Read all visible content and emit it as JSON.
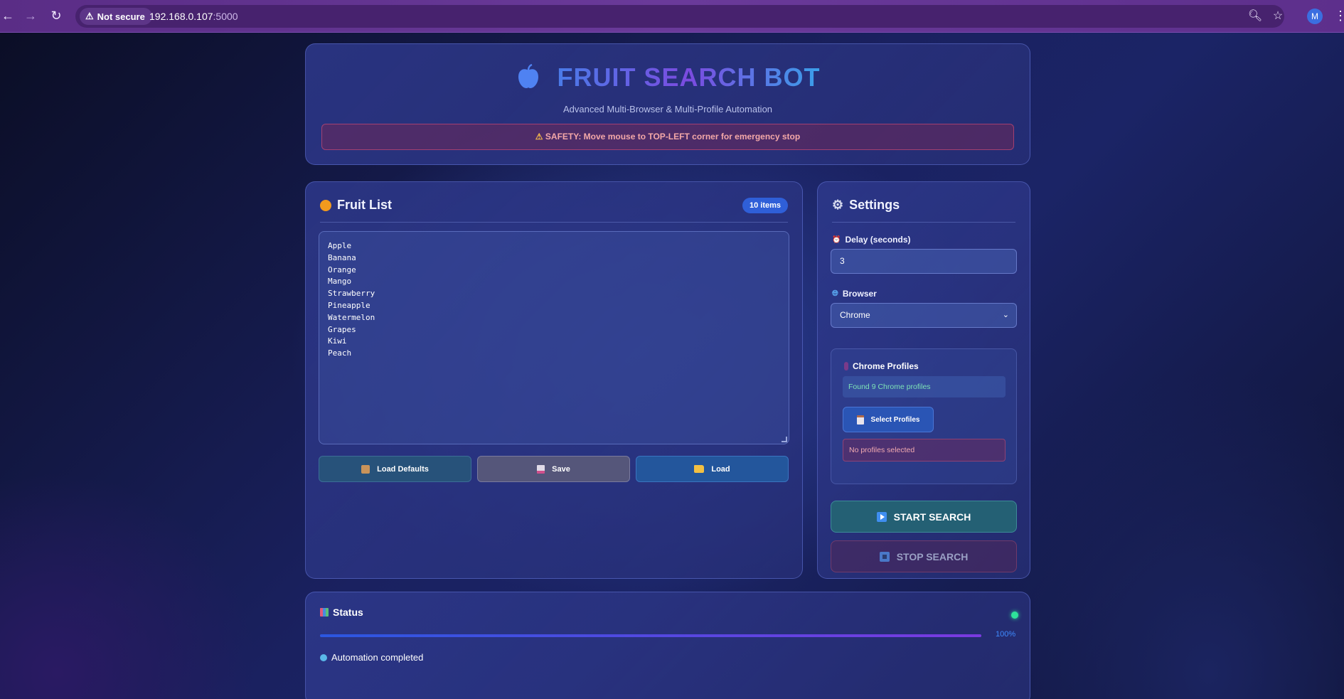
{
  "browser": {
    "security_label": "Not secure",
    "url_host": "192.168.0.107",
    "url_port": ":5000",
    "avatar_letter": "M"
  },
  "header": {
    "title": "FRUIT SEARCH BOT",
    "subtitle": "Advanced Multi-Browser & Multi-Profile Automation",
    "safety_warning": "SAFETY: Move mouse to TOP-LEFT corner for emergency stop"
  },
  "fruit_list": {
    "title": "Fruit List",
    "count_badge": "10 items",
    "items": [
      "Apple",
      "Banana",
      "Orange",
      "Mango",
      "Strawberry",
      "Pineapple",
      "Watermelon",
      "Grapes",
      "Kiwi",
      "Peach"
    ],
    "buttons": {
      "load_defaults": "Load Defaults",
      "save": "Save",
      "load": "Load"
    }
  },
  "settings": {
    "title": "Settings",
    "delay_label": "Delay (seconds)",
    "delay_value": "3",
    "browser_label": "Browser",
    "browser_value": "Chrome",
    "profiles": {
      "title": "Chrome Profiles",
      "found_text": "Found 9 Chrome profiles",
      "select_button": "Select Profiles",
      "selection_status": "No profiles selected"
    },
    "start_button": "START SEARCH",
    "stop_button": "STOP SEARCH"
  },
  "status": {
    "title": "Status",
    "progress": 1.0,
    "progress_label": "100%",
    "message": "Automation completed"
  },
  "colors": {
    "accent_blue": "#2f5fd8",
    "status_ok": "#2ee29a",
    "warning_text": "#f4a8a8"
  }
}
